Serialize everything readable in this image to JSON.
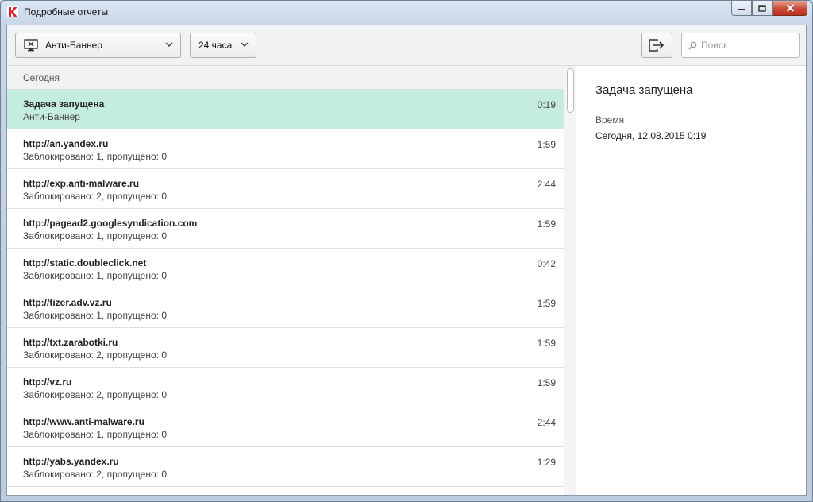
{
  "window": {
    "title": "Подробные отчеты"
  },
  "toolbar": {
    "category": {
      "label": "Анти-Баннер",
      "icon": "monitor-x-icon"
    },
    "period": {
      "label": "24 часа"
    },
    "export_icon": "export-icon",
    "search": {
      "placeholder": "Поиск",
      "value": ""
    }
  },
  "list": {
    "section_label": "Сегодня",
    "items": [
      {
        "title": "Задача запущена",
        "subtitle": "Анти-Баннер",
        "time": "0:19",
        "selected": true
      },
      {
        "title": "http://an.yandex.ru",
        "subtitle": "Заблокировано: 1, пропущено: 0",
        "time": "1:59"
      },
      {
        "title": "http://exp.anti-malware.ru",
        "subtitle": "Заблокировано: 2, пропущено: 0",
        "time": "2:44"
      },
      {
        "title": "http://pagead2.googlesyndication.com",
        "subtitle": "Заблокировано: 1, пропущено: 0",
        "time": "1:59"
      },
      {
        "title": "http://static.doubleclick.net",
        "subtitle": "Заблокировано: 1, пропущено: 0",
        "time": "0:42"
      },
      {
        "title": "http://tizer.adv.vz.ru",
        "subtitle": "Заблокировано: 1, пропущено: 0",
        "time": "1:59"
      },
      {
        "title": "http://txt.zarabotki.ru",
        "subtitle": "Заблокировано: 2, пропущено: 0",
        "time": "1:59"
      },
      {
        "title": "http://vz.ru",
        "subtitle": "Заблокировано: 2, пропущено: 0",
        "time": "1:59"
      },
      {
        "title": "http://www.anti-malware.ru",
        "subtitle": "Заблокировано: 1, пропущено: 0",
        "time": "2:44"
      },
      {
        "title": "http://yabs.yandex.ru",
        "subtitle": "Заблокировано: 2, пропущено: 0",
        "time": "1:29"
      }
    ]
  },
  "detail": {
    "title": "Задача запущена",
    "field_label": "Время",
    "field_value": "Сегодня, 12.08.2015 0:19"
  },
  "colors": {
    "selected_row": "#c4ece0",
    "brand_red": "#d4262b"
  }
}
